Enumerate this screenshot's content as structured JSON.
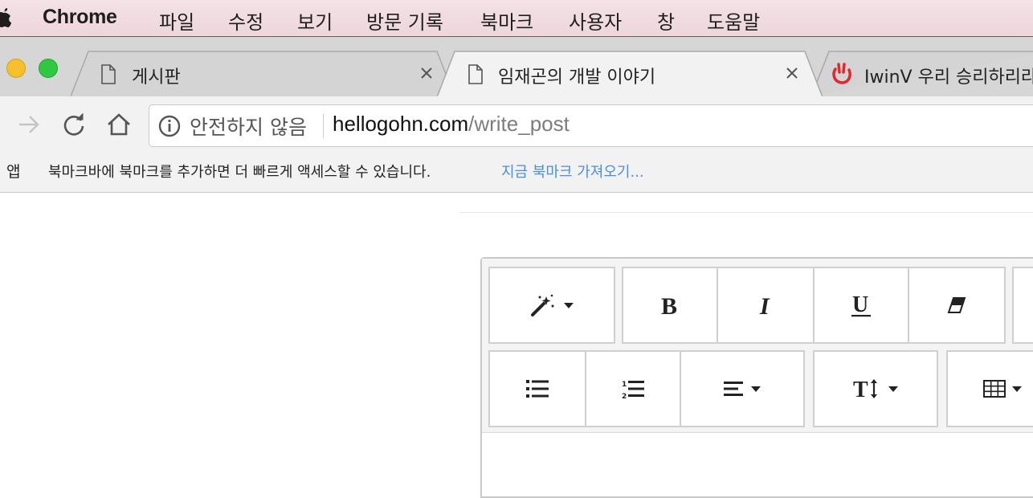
{
  "menubar": {
    "app_name": "Chrome",
    "items": [
      "파일",
      "수정",
      "보기",
      "방문 기록",
      "북마크",
      "사용자",
      "창",
      "도움말"
    ]
  },
  "tabs": [
    {
      "title": "게시판",
      "active": false,
      "icon": "document-icon"
    },
    {
      "title": "임재곤의 개발 이야기",
      "active": true,
      "icon": "document-icon"
    },
    {
      "title": "IwinV 우리 승리하리라",
      "active": false,
      "icon": "iwinv-logo-icon"
    }
  ],
  "omnibox": {
    "security_label": "안전하지 않음",
    "url_domain": "hellogohn.com",
    "url_path": "/write_post"
  },
  "bookmarks_bar": {
    "apps_label": "앱",
    "hint": "북마크바에 북마크를 추가하면 더 빠르게 액세스할 수 있습니다.",
    "import_link": "지금 북마크 가져오기..."
  },
  "editor_toolbar": {
    "row1": [
      "magic-style-icon",
      "bold-icon",
      "italic-icon",
      "underline-icon",
      "eraser-icon"
    ],
    "row2": [
      "unordered-list-icon",
      "ordered-list-icon",
      "paragraph-align-icon",
      "font-size-icon",
      "table-icon"
    ]
  },
  "colors": {
    "menubar": "#ecd6db",
    "link": "#4a8fdc",
    "traffic_yellow": "#f6bf2d",
    "traffic_green": "#2fc840"
  }
}
